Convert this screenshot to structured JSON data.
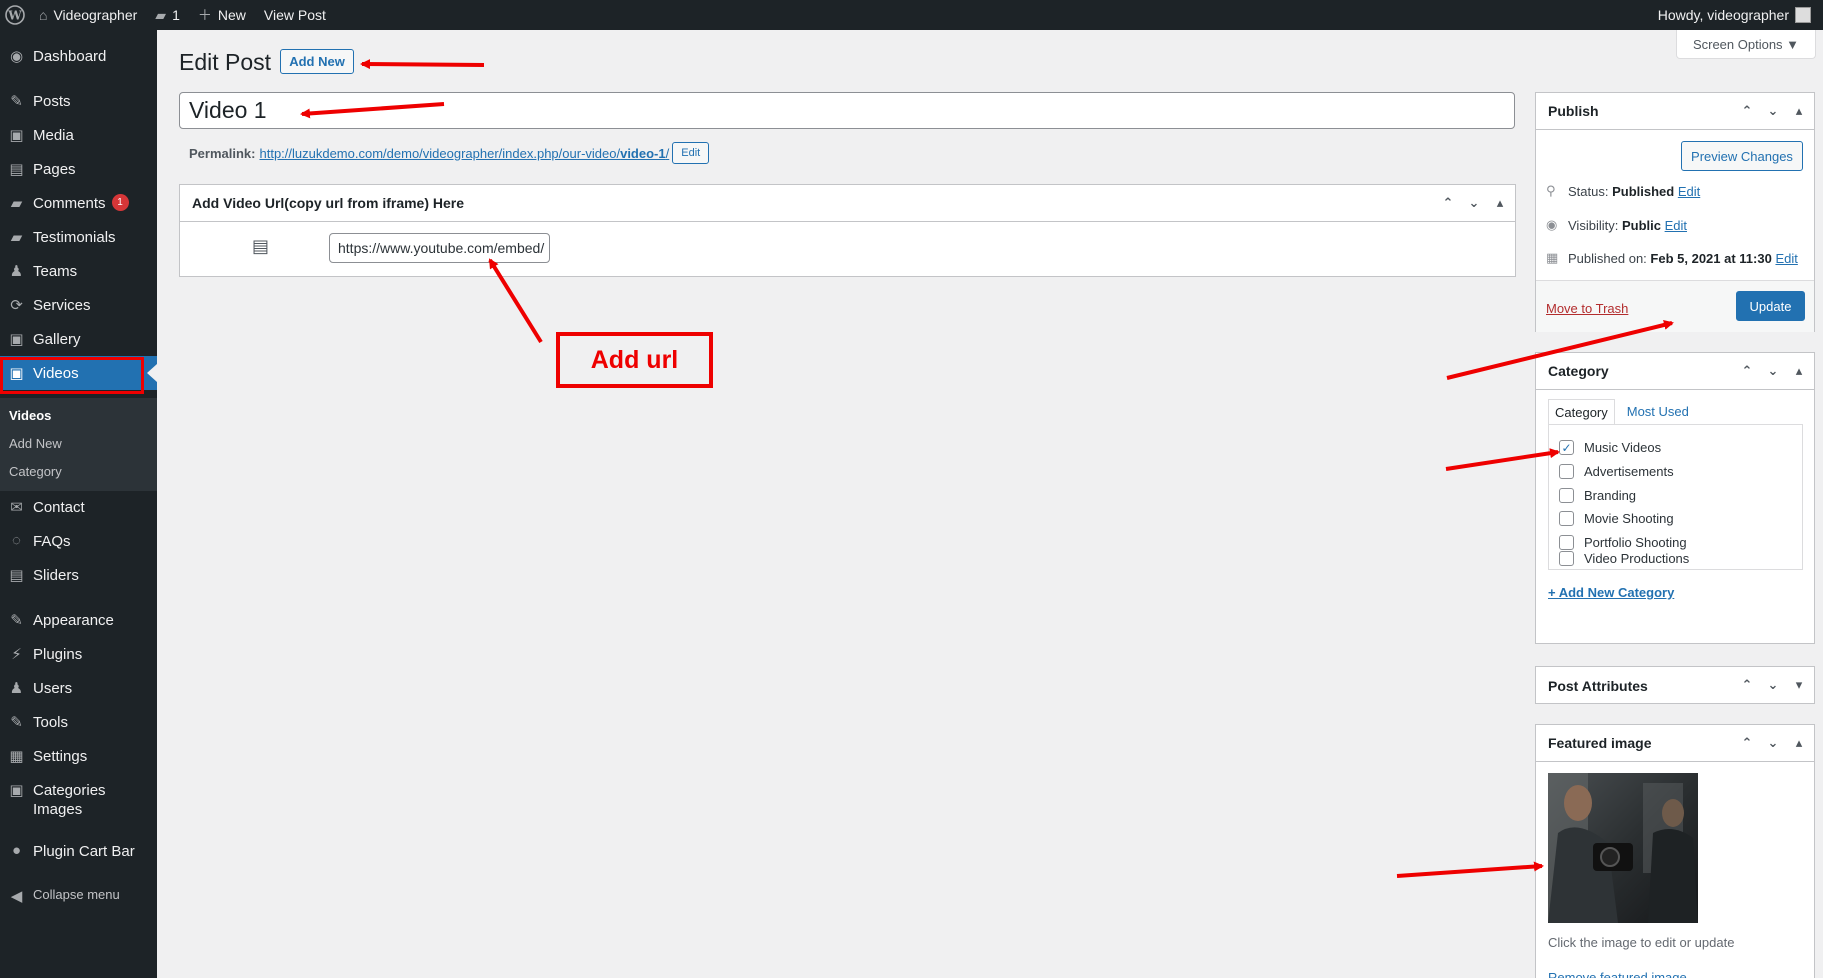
{
  "adminbar": {
    "site_name": "Videographer",
    "comments_count": "1",
    "new_label": "New",
    "view_post": "View Post",
    "howdy": "Howdy, videographer"
  },
  "sidebar": {
    "items": [
      {
        "label": "Dashboard",
        "icon": "dashboard-icon",
        "glyph": "◉"
      },
      {
        "label": "Posts",
        "icon": "pin-icon",
        "glyph": "✎"
      },
      {
        "label": "Media",
        "icon": "media-icon",
        "glyph": "▣"
      },
      {
        "label": "Pages",
        "icon": "pages-icon",
        "glyph": "▤"
      },
      {
        "label": "Comments",
        "icon": "comments-icon",
        "glyph": "▰",
        "badge": "1"
      },
      {
        "label": "Testimonials",
        "icon": "testimonials-icon",
        "glyph": "▰"
      },
      {
        "label": "Teams",
        "icon": "teams-icon",
        "glyph": "♟"
      },
      {
        "label": "Services",
        "icon": "services-icon",
        "glyph": "⟳"
      },
      {
        "label": "Gallery",
        "icon": "gallery-icon",
        "glyph": "▣"
      },
      {
        "label": "Videos",
        "icon": "videos-icon",
        "glyph": "▣"
      },
      {
        "label": "Contact",
        "icon": "envelope-icon",
        "glyph": "✉"
      },
      {
        "label": "FAQs",
        "icon": "faq-icon",
        "glyph": "◌"
      },
      {
        "label": "Sliders",
        "icon": "sliders-icon",
        "glyph": "▤"
      },
      {
        "label": "Appearance",
        "icon": "brush-icon",
        "glyph": "✎"
      },
      {
        "label": "Plugins",
        "icon": "plugin-icon",
        "glyph": "⚡"
      },
      {
        "label": "Users",
        "icon": "user-icon",
        "glyph": "♟"
      },
      {
        "label": "Tools",
        "icon": "wrench-icon",
        "glyph": "✎"
      },
      {
        "label": "Settings",
        "icon": "settings-icon",
        "glyph": "▦"
      },
      {
        "label": "Categories Images",
        "icon": "image-icon",
        "glyph": "▣"
      },
      {
        "label": "Plugin Cart Bar",
        "icon": "cart-bar-icon",
        "glyph": "●"
      }
    ],
    "submenu": [
      "Videos",
      "Add New",
      "Category"
    ],
    "collapse": "Collapse menu"
  },
  "main": {
    "title": "Edit Post",
    "add_new": "Add New",
    "screen_options": "Screen Options ▼",
    "post_title": "Video 1",
    "permalink_label": "Permalink:",
    "permalink_url_base": "http://luzukdemo.com/demo/videographer/index.php/our-video/",
    "permalink_slug": "video-1",
    "permalink_suffix": "/",
    "permalink_edit": "Edit",
    "video_box_title": "Add Video Url(copy url from iframe) Here",
    "video_url": "https://www.youtube.com/embed/"
  },
  "publish": {
    "title": "Publish",
    "preview": "Preview Changes",
    "status_label": "Status:",
    "status_value": "Published",
    "visibility_label": "Visibility:",
    "visibility_value": "Public",
    "published_label": "Published on:",
    "published_value": "Feb 5, 2021 at 11:30",
    "edit": "Edit",
    "trash": "Move to Trash",
    "update": "Update"
  },
  "category": {
    "title": "Category",
    "tab_all": "Category",
    "tab_most_used": "Most Used",
    "items": [
      {
        "label": "Music Videos",
        "checked": true
      },
      {
        "label": "Advertisements",
        "checked": false
      },
      {
        "label": "Branding",
        "checked": false
      },
      {
        "label": "Movie Shooting",
        "checked": false
      },
      {
        "label": "Portfolio Shooting",
        "checked": false
      },
      {
        "label": "Video Productions",
        "checked": false
      }
    ],
    "add_new": "+ Add New Category"
  },
  "post_attributes": {
    "title": "Post Attributes"
  },
  "featured": {
    "title": "Featured image",
    "caption": "Click the image to edit or update",
    "remove": "Remove featured image"
  },
  "annotation": {
    "add_url": "Add url"
  },
  "colors": {
    "accent": "#2271b1",
    "sidebar_bg": "#1d2327",
    "annotation": "#e00000"
  }
}
